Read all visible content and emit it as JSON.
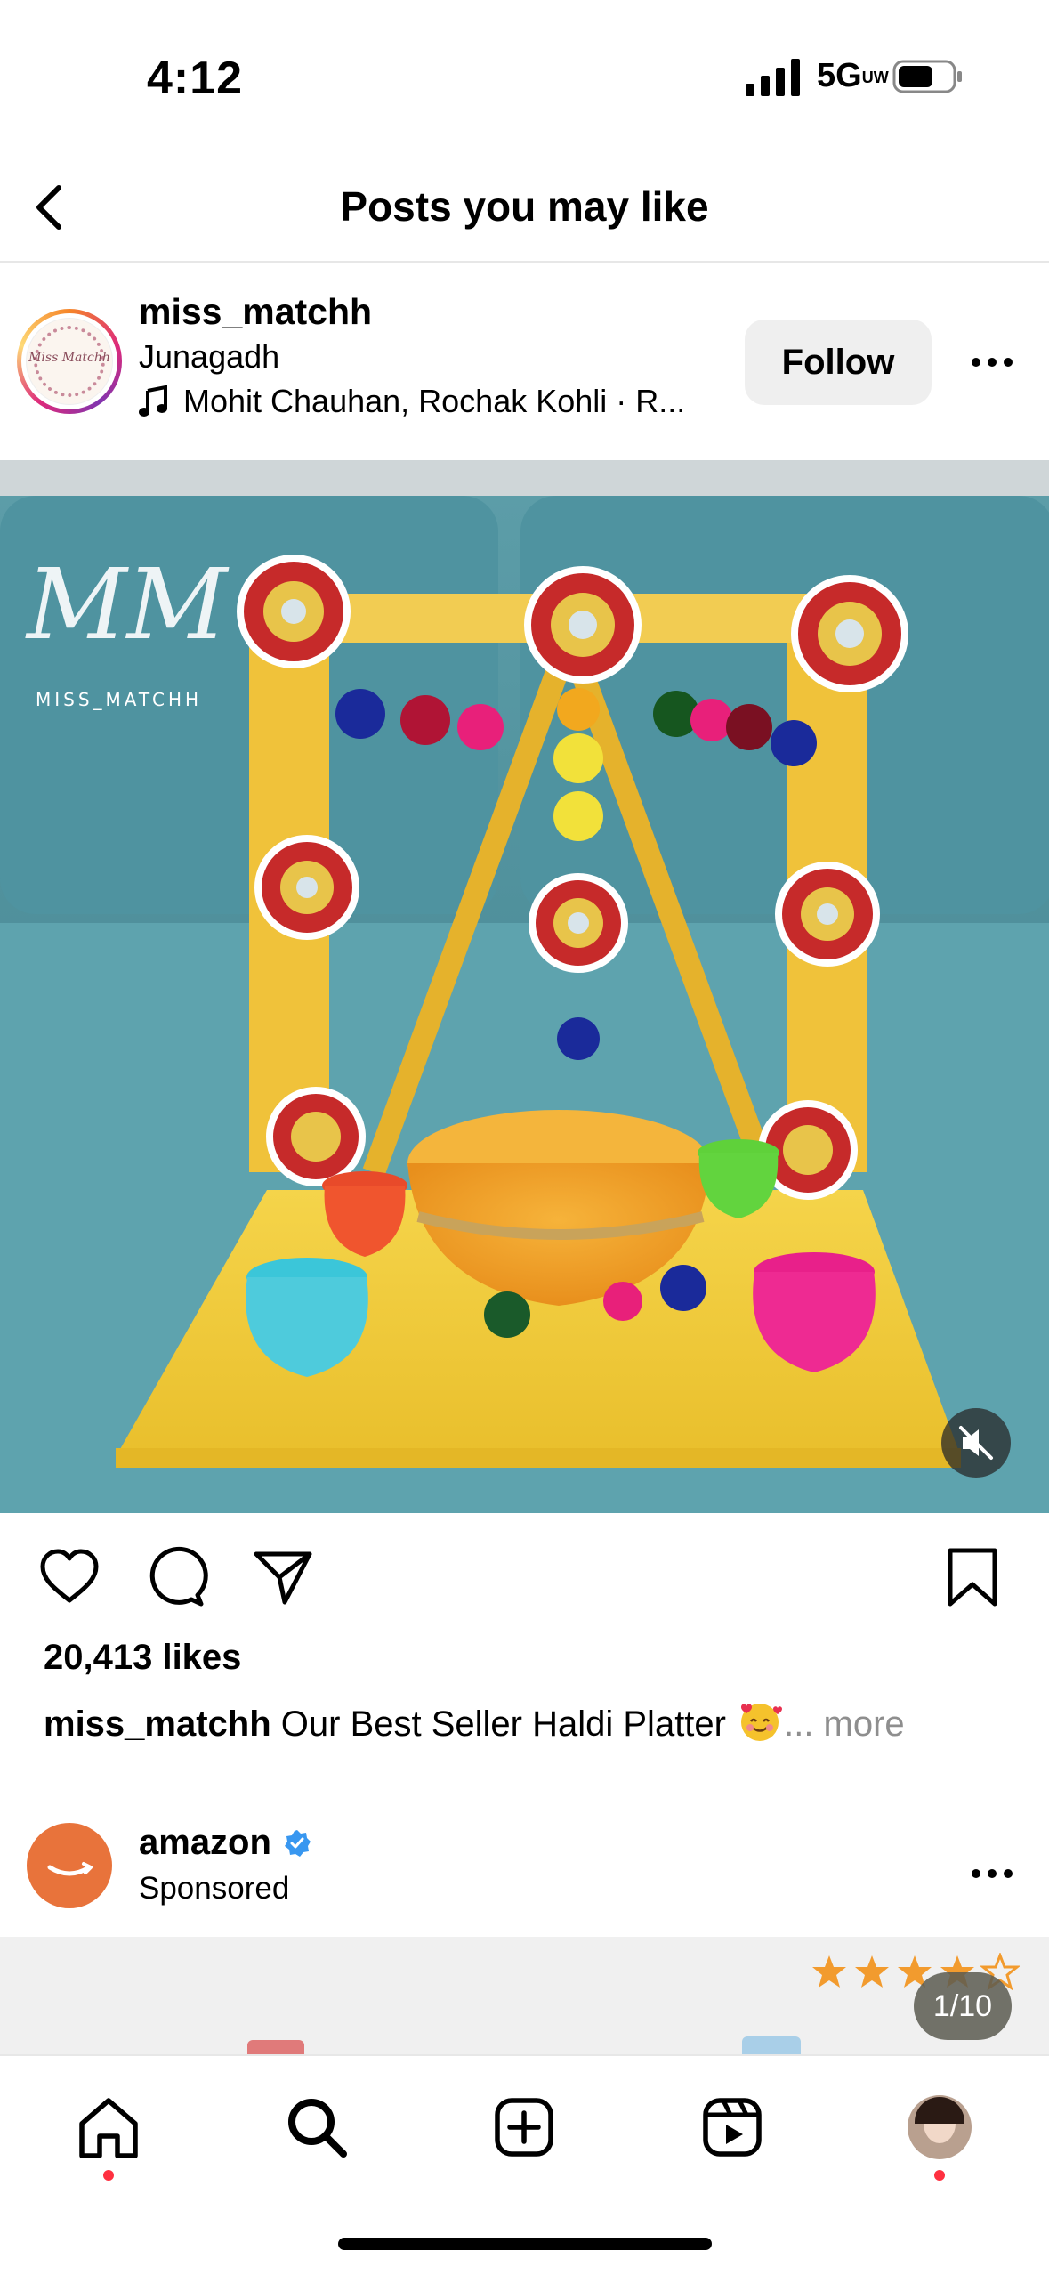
{
  "status": {
    "time": "4:12",
    "network": "5G",
    "network_suffix": "UW"
  },
  "header": {
    "title": "Posts you may like"
  },
  "post": {
    "username": "miss_matchh",
    "location": "Junagadh",
    "music": "Mohit Chauhan,  Rochak Kohli · R...",
    "follow_label": "Follow",
    "avatar_text": "Miss Matchh",
    "watermark_letters": "MM",
    "watermark_text": "MISS_MATCHH",
    "likes": "20,413 likes",
    "caption_user": "miss_matchh",
    "caption_text": " Our Best Seller Haldi Platter ",
    "caption_more": "... more"
  },
  "sponsored": {
    "name": "amazon",
    "label": "Sponsored",
    "counter": "1/10",
    "rating_stars": 5
  },
  "nav": {
    "tabs": [
      "home",
      "search",
      "create",
      "reels",
      "profile"
    ]
  },
  "colors": {
    "follow_bg": "#efefef",
    "notification_dot": "#ff3040",
    "amazon_orange": "#e8733b",
    "verified_blue": "#3897f0",
    "star_orange": "#f29b2e"
  },
  "icons": {
    "back": "chevron-left-icon",
    "like": "heart-icon",
    "comment": "comment-icon",
    "share": "paper-plane-icon",
    "save": "bookmark-icon",
    "mute": "speaker-muted-icon",
    "music": "music-note-icon"
  }
}
